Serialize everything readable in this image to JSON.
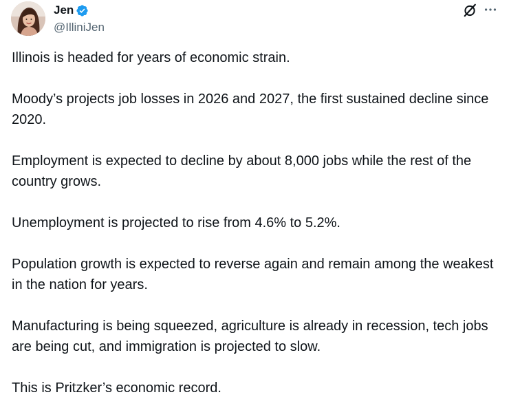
{
  "author": {
    "display_name": "Jen",
    "handle": "@IlliniJen",
    "verified": true,
    "verified_color": "#1d9bf0"
  },
  "icons": {
    "verified": "verified-badge-icon",
    "grok": "grok-icon",
    "more": "more-horizontal-icon"
  },
  "tweet": {
    "paragraphs": [
      "Illinois is headed for years of economic strain.",
      "Moody’s projects job losses in 2026 and 2027, the first sustained decline since 2020.",
      "Employment is expected to decline by about 8,000 jobs while the rest of the country grows.",
      "Unemployment is projected to rise from 4.6% to 5.2%.",
      "Population growth is expected to reverse again and remain among the weakest in the nation for years.",
      "Manufacturing is being squeezed, agriculture is already in recession, tech jobs are being cut, and immigration is projected to slow.",
      "This is Pritzker’s economic record."
    ]
  },
  "colors": {
    "text": "#0f1419",
    "secondary": "#536471",
    "accent": "#1d9bf0"
  }
}
